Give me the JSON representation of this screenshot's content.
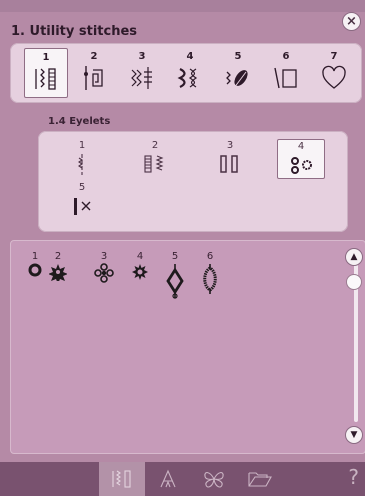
{
  "header": {
    "category_title": "1. Utility stitches",
    "close_label": "×"
  },
  "categories": [
    {
      "num": "1",
      "icon": "utility-stitch-icon",
      "selected": true
    },
    {
      "num": "2",
      "icon": "stretch-stitch-icon",
      "selected": false
    },
    {
      "num": "3",
      "icon": "quilt-stitch-icon",
      "selected": false
    },
    {
      "num": "4",
      "icon": "satin-stitch-icon",
      "selected": false
    },
    {
      "num": "5",
      "icon": "decorative-stitch-icon",
      "selected": false
    },
    {
      "num": "6",
      "icon": "buttonhole-stitch-icon",
      "selected": false
    },
    {
      "num": "7",
      "icon": "heart-stitch-icon",
      "selected": false
    }
  ],
  "subcategory": {
    "title": "1.4 Eyelets",
    "items": [
      {
        "num": "1",
        "icon": "straight-stitch-icon"
      },
      {
        "num": "2",
        "icon": "zigzag-stitch-icon"
      },
      {
        "num": "3",
        "icon": "bar-stitch-icon"
      },
      {
        "num": "4",
        "icon": "eyelet-stitch-icon",
        "selected": true
      },
      {
        "num": "5",
        "icon": "bartack-stitch-icon"
      }
    ]
  },
  "stitches": [
    {
      "num": "1",
      "icon": "round-eyelet-icon"
    },
    {
      "num": "2",
      "icon": "star-eyelet-icon"
    },
    {
      "num": "3",
      "icon": "flower-eyelet-icon"
    },
    {
      "num": "4",
      "icon": "sun-eyelet-icon"
    },
    {
      "num": "5",
      "icon": "teardrop-eyelet-icon"
    },
    {
      "num": "6",
      "icon": "oval-eyelet-icon"
    }
  ],
  "scroll": {
    "up_label": "▲",
    "down_label": "▼"
  },
  "bottom_tabs": [
    {
      "icon": "stitch-menu-icon",
      "selected": true
    },
    {
      "icon": "font-menu-icon",
      "selected": false
    },
    {
      "icon": "embroidery-menu-icon",
      "selected": false
    },
    {
      "icon": "folder-icon",
      "selected": false
    }
  ],
  "help_label": "?",
  "colors": {
    "background": "#b58aa6",
    "panel": "#e6d0df",
    "selected": "#f8f4f7",
    "bottom_bar": "#79526f"
  }
}
